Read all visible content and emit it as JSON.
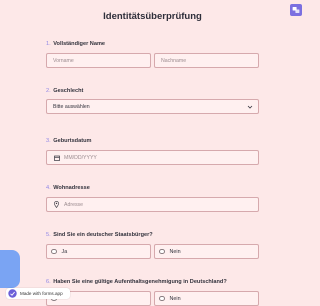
{
  "page": {
    "title": "Identitätsüberprüfung"
  },
  "questions": {
    "q1": {
      "num": "1.",
      "label": "Vollständiger Name",
      "first_placeholder": "Vorname",
      "last_placeholder": "Nachname"
    },
    "q2": {
      "num": "2.",
      "label": "Geschlecht",
      "value": "Bitte auswählen"
    },
    "q3": {
      "num": "3.",
      "label": "Geburtsdatum",
      "placeholder": "MM/DD/YYYY"
    },
    "q4": {
      "num": "4.",
      "label": "Wohnadresse",
      "placeholder": "Adresse"
    },
    "q5": {
      "num": "5.",
      "label": "Sind Sie ein deutscher Staatsbürger?",
      "yes": "Ja",
      "no": "Nein"
    },
    "q6": {
      "num": "6.",
      "label": "Haben Sie eine gültige Aufenthaltsgenehmigung in Deutschland?",
      "no": "Nein"
    }
  },
  "badge": {
    "text": "Made with forms.app"
  },
  "colors": {
    "background": "#fde8e8",
    "accent": "#8f86e6",
    "border": "#d6a9ad"
  },
  "icons": [
    "translate-icon",
    "calendar-icon",
    "location-pin-icon",
    "chevron-down-icon",
    "forms-app-logo-icon"
  ]
}
